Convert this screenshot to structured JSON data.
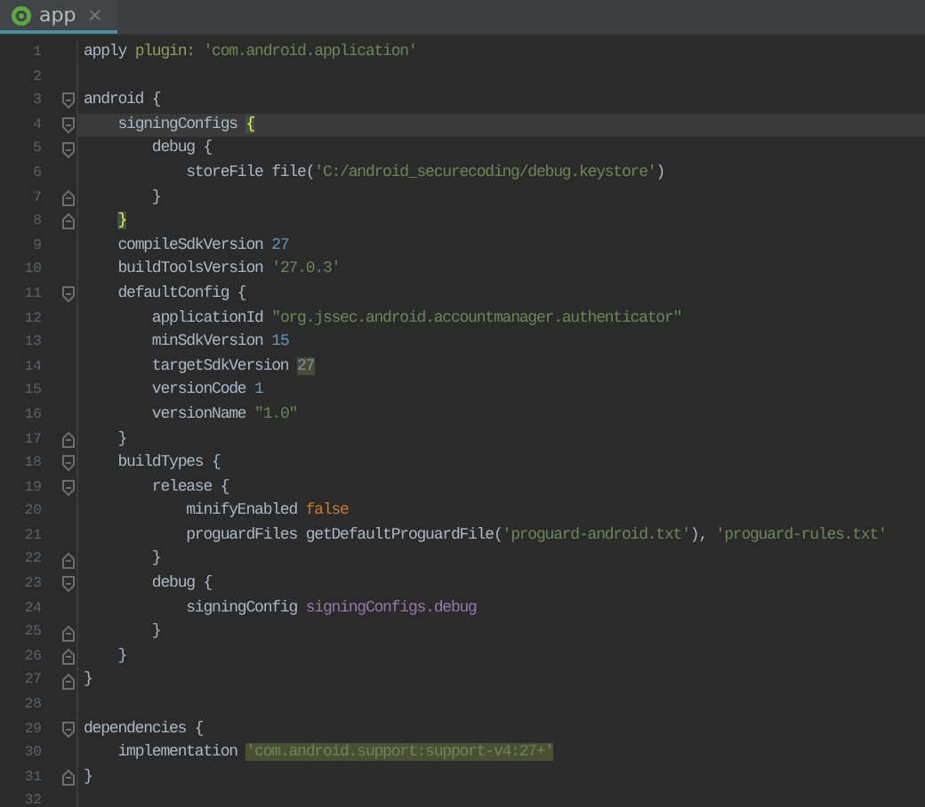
{
  "tab": {
    "label": "app",
    "close": "×",
    "selected": true
  },
  "lines": [
    {
      "number": "1",
      "kind": "plain",
      "current": false,
      "tokens": [
        {
          "kind": "plain",
          "text": "apply "
        },
        {
          "kind": "named",
          "text": "plugin: "
        },
        {
          "kind": "string",
          "text": "'com.android.application'"
        }
      ]
    },
    {
      "number": "2",
      "kind": "plain",
      "current": false
    },
    {
      "number": "3",
      "kind": "fold-start",
      "current": false,
      "tokens": [
        {
          "kind": "plain",
          "text": "android {"
        }
      ]
    },
    {
      "number": "4",
      "kind": "fold-start",
      "current": true,
      "tokens": [
        {
          "kind": "plain",
          "text": "    signingConfigs "
        },
        {
          "kind": "brace",
          "text": "{",
          "highlighted": true
        }
      ]
    },
    {
      "number": "5",
      "kind": "fold-start",
      "current": false,
      "tokens": [
        {
          "kind": "plain",
          "text": "        debug {"
        }
      ]
    },
    {
      "number": "6",
      "kind": "plain",
      "current": false,
      "tokens": [
        {
          "kind": "plain",
          "text": "            storeFile file("
        },
        {
          "kind": "string",
          "text": "'C:/android_securecoding/debug.keystore'"
        },
        {
          "kind": "plain",
          "text": ")"
        }
      ]
    },
    {
      "number": "7",
      "kind": "fold-end",
      "current": false,
      "tokens": [
        {
          "kind": "plain",
          "text": "        }"
        }
      ]
    },
    {
      "number": "8",
      "kind": "fold-end",
      "current": false,
      "tokens": [
        {
          "kind": "brace",
          "text": "    }",
          "highlighted": true
        }
      ]
    },
    {
      "number": "9",
      "kind": "plain",
      "current": false,
      "tokens": [
        {
          "kind": "plain",
          "text": "    compileSdkVersion "
        },
        {
          "kind": "number",
          "text": "27"
        }
      ]
    },
    {
      "number": "10",
      "kind": "plain",
      "current": false,
      "tokens": [
        {
          "kind": "plain",
          "text": "    buildToolsVersion "
        },
        {
          "kind": "string",
          "text": "'27.0.3'"
        }
      ]
    },
    {
      "number": "11",
      "kind": "fold-start",
      "current": false,
      "tokens": [
        {
          "kind": "plain",
          "text": "    defaultConfig {"
        }
      ]
    },
    {
      "number": "12",
      "kind": "plain",
      "current": false,
      "tokens": [
        {
          "kind": "plain",
          "text": "        applicationId "
        },
        {
          "kind": "string",
          "text": "\"org.jssec.android.accountmanager.authenticator\""
        }
      ]
    },
    {
      "number": "13",
      "kind": "plain",
      "current": false,
      "tokens": [
        {
          "kind": "plain",
          "text": "        minSdkVersion "
        },
        {
          "kind": "number",
          "text": "15"
        }
      ]
    },
    {
      "number": "14",
      "kind": "plain",
      "current": false,
      "tokens": [
        {
          "kind": "plain",
          "text": "        targetSdkVersion "
        },
        {
          "kind": "number",
          "text": "27",
          "highlighted": true
        }
      ]
    },
    {
      "number": "15",
      "kind": "plain",
      "current": false,
      "tokens": [
        {
          "kind": "plain",
          "text": "        versionCode "
        },
        {
          "kind": "number",
          "text": "1"
        }
      ]
    },
    {
      "number": "16",
      "kind": "plain",
      "current": false,
      "tokens": [
        {
          "kind": "plain",
          "text": "        versionName "
        },
        {
          "kind": "string",
          "text": "\"1.0\""
        }
      ]
    },
    {
      "number": "17",
      "kind": "fold-end",
      "current": false,
      "tokens": [
        {
          "kind": "plain",
          "text": "    }"
        }
      ]
    },
    {
      "number": "18",
      "kind": "fold-start",
      "current": false,
      "tokens": [
        {
          "kind": "plain",
          "text": "    buildTypes {"
        }
      ]
    },
    {
      "number": "19",
      "kind": "fold-start",
      "current": false,
      "tokens": [
        {
          "kind": "plain",
          "text": "        release {"
        }
      ]
    },
    {
      "number": "20",
      "kind": "plain",
      "current": false,
      "tokens": [
        {
          "kind": "plain",
          "text": "            minifyEnabled "
        },
        {
          "kind": "keyword",
          "text": "false"
        }
      ]
    },
    {
      "number": "21",
      "kind": "plain",
      "current": false,
      "tokens": [
        {
          "kind": "plain",
          "text": "            proguardFiles getDefaultProguardFile("
        },
        {
          "kind": "string",
          "text": "'proguard-android.txt'"
        },
        {
          "kind": "plain",
          "text": "), "
        },
        {
          "kind": "string",
          "text": "'proguard-rules.txt'"
        }
      ]
    },
    {
      "number": "22",
      "kind": "fold-end",
      "current": false,
      "tokens": [
        {
          "kind": "plain",
          "text": "        }"
        }
      ]
    },
    {
      "number": "23",
      "kind": "fold-start",
      "current": false,
      "tokens": [
        {
          "kind": "plain",
          "text": "        debug {"
        }
      ]
    },
    {
      "number": "24",
      "kind": "plain",
      "current": false,
      "tokens": [
        {
          "kind": "plain",
          "text": "            signingConfig "
        },
        {
          "kind": "field",
          "text": "signingConfigs.debug"
        }
      ]
    },
    {
      "number": "25",
      "kind": "fold-end",
      "current": false,
      "tokens": [
        {
          "kind": "plain",
          "text": "        }"
        }
      ]
    },
    {
      "number": "26",
      "kind": "fold-end",
      "current": false,
      "tokens": [
        {
          "kind": "plain",
          "text": "    }"
        }
      ]
    },
    {
      "number": "27",
      "kind": "fold-end",
      "current": false,
      "tokens": [
        {
          "kind": "plain",
          "text": "}"
        }
      ]
    },
    {
      "number": "28",
      "kind": "plain",
      "current": false
    },
    {
      "number": "29",
      "kind": "fold-start",
      "current": false,
      "tokens": [
        {
          "kind": "plain",
          "text": "dependencies {"
        }
      ]
    },
    {
      "number": "30",
      "kind": "plain",
      "current": false,
      "tokens": [
        {
          "kind": "plain",
          "text": "    implementation "
        },
        {
          "kind": "string",
          "text": "'com.android.support:support-v4:27+'",
          "highlighted": true
        }
      ]
    },
    {
      "number": "31",
      "kind": "fold-end",
      "current": false,
      "tokens": [
        {
          "kind": "plain",
          "text": "}"
        }
      ]
    },
    {
      "number": "32",
      "kind": "plain",
      "current": false
    }
  ]
}
